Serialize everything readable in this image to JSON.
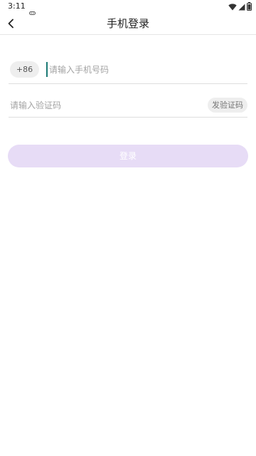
{
  "status_bar": {
    "time": "3:11",
    "notification_icon": "gamepad-icon",
    "icons": [
      "wifi-icon",
      "cellular-signal-icon",
      "battery-icon"
    ]
  },
  "header": {
    "back_icon": "chevron-left-icon",
    "title": "手机登录"
  },
  "phone": {
    "country_code": "+86",
    "value": "",
    "placeholder": "请输入手机号码"
  },
  "verification": {
    "value": "",
    "placeholder": "请输入验证码",
    "send_label": "发验证码"
  },
  "login": {
    "label": "登录",
    "color": "#e7dcf6",
    "enabled": false
  },
  "colors": {
    "cursor": "#1b7a75",
    "chip_background": "#eeeeee",
    "divider": "#dedede"
  }
}
